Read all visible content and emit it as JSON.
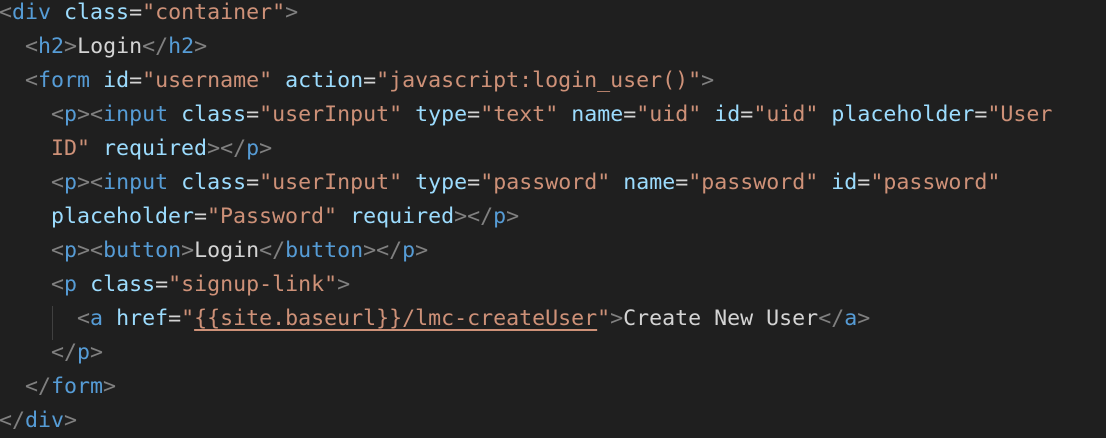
{
  "code_lines": [
    [
      {
        "t": "<",
        "c": "punct"
      },
      {
        "t": "div",
        "c": "tag"
      },
      {
        "t": " ",
        "c": "txt"
      },
      {
        "t": "class",
        "c": "attr"
      },
      {
        "t": "=",
        "c": "txt"
      },
      {
        "t": "\"container\"",
        "c": "str"
      },
      {
        "t": ">",
        "c": "punct"
      }
    ],
    [
      {
        "t": "  ",
        "c": "txt"
      },
      {
        "t": "<",
        "c": "punct"
      },
      {
        "t": "h2",
        "c": "tag"
      },
      {
        "t": ">",
        "c": "punct"
      },
      {
        "t": "Login",
        "c": "txt"
      },
      {
        "t": "</",
        "c": "punct"
      },
      {
        "t": "h2",
        "c": "tag"
      },
      {
        "t": ">",
        "c": "punct"
      }
    ],
    [
      {
        "t": "  ",
        "c": "txt"
      },
      {
        "t": "<",
        "c": "punct"
      },
      {
        "t": "form",
        "c": "tag"
      },
      {
        "t": " ",
        "c": "txt"
      },
      {
        "t": "id",
        "c": "attr"
      },
      {
        "t": "=",
        "c": "txt"
      },
      {
        "t": "\"username\"",
        "c": "str"
      },
      {
        "t": " ",
        "c": "txt"
      },
      {
        "t": "action",
        "c": "attr"
      },
      {
        "t": "=",
        "c": "txt"
      },
      {
        "t": "\"javascript:login_user()\"",
        "c": "str"
      },
      {
        "t": ">",
        "c": "punct"
      }
    ],
    [
      {
        "t": "    ",
        "c": "txt"
      },
      {
        "t": "<",
        "c": "punct"
      },
      {
        "t": "p",
        "c": "tag"
      },
      {
        "t": "><",
        "c": "punct"
      },
      {
        "t": "input",
        "c": "tag"
      },
      {
        "t": " ",
        "c": "txt"
      },
      {
        "t": "class",
        "c": "attr"
      },
      {
        "t": "=",
        "c": "txt"
      },
      {
        "t": "\"userInput\"",
        "c": "str"
      },
      {
        "t": " ",
        "c": "txt"
      },
      {
        "t": "type",
        "c": "attr"
      },
      {
        "t": "=",
        "c": "txt"
      },
      {
        "t": "\"text\"",
        "c": "str"
      },
      {
        "t": " ",
        "c": "txt"
      },
      {
        "t": "name",
        "c": "attr"
      },
      {
        "t": "=",
        "c": "txt"
      },
      {
        "t": "\"uid\"",
        "c": "str"
      },
      {
        "t": " ",
        "c": "txt"
      },
      {
        "t": "id",
        "c": "attr"
      },
      {
        "t": "=",
        "c": "txt"
      },
      {
        "t": "\"uid\"",
        "c": "str"
      },
      {
        "t": " ",
        "c": "txt"
      },
      {
        "t": "placeholder",
        "c": "attr"
      },
      {
        "t": "=",
        "c": "txt"
      },
      {
        "t": "\"User",
        "c": "str"
      }
    ],
    [
      {
        "t": "    ",
        "c": "txt"
      },
      {
        "t": "ID\"",
        "c": "str"
      },
      {
        "t": " ",
        "c": "txt"
      },
      {
        "t": "required",
        "c": "attr"
      },
      {
        "t": "></",
        "c": "punct"
      },
      {
        "t": "p",
        "c": "tag"
      },
      {
        "t": ">",
        "c": "punct"
      }
    ],
    [
      {
        "t": "    ",
        "c": "txt"
      },
      {
        "t": "<",
        "c": "punct"
      },
      {
        "t": "p",
        "c": "tag"
      },
      {
        "t": "><",
        "c": "punct"
      },
      {
        "t": "input",
        "c": "tag"
      },
      {
        "t": " ",
        "c": "txt"
      },
      {
        "t": "class",
        "c": "attr"
      },
      {
        "t": "=",
        "c": "txt"
      },
      {
        "t": "\"userInput\"",
        "c": "str"
      },
      {
        "t": " ",
        "c": "txt"
      },
      {
        "t": "type",
        "c": "attr"
      },
      {
        "t": "=",
        "c": "txt"
      },
      {
        "t": "\"password\"",
        "c": "str"
      },
      {
        "t": " ",
        "c": "txt"
      },
      {
        "t": "name",
        "c": "attr"
      },
      {
        "t": "=",
        "c": "txt"
      },
      {
        "t": "\"password\"",
        "c": "str"
      },
      {
        "t": " ",
        "c": "txt"
      },
      {
        "t": "id",
        "c": "attr"
      },
      {
        "t": "=",
        "c": "txt"
      },
      {
        "t": "\"password\"",
        "c": "str"
      }
    ],
    [
      {
        "t": "    ",
        "c": "txt"
      },
      {
        "t": "placeholder",
        "c": "attr"
      },
      {
        "t": "=",
        "c": "txt"
      },
      {
        "t": "\"Password\"",
        "c": "str"
      },
      {
        "t": " ",
        "c": "txt"
      },
      {
        "t": "required",
        "c": "attr"
      },
      {
        "t": "></",
        "c": "punct"
      },
      {
        "t": "p",
        "c": "tag"
      },
      {
        "t": ">",
        "c": "punct"
      }
    ],
    [
      {
        "t": "    ",
        "c": "txt"
      },
      {
        "t": "<",
        "c": "punct"
      },
      {
        "t": "p",
        "c": "tag"
      },
      {
        "t": "><",
        "c": "punct"
      },
      {
        "t": "button",
        "c": "tag"
      },
      {
        "t": ">",
        "c": "punct"
      },
      {
        "t": "Login",
        "c": "txt"
      },
      {
        "t": "</",
        "c": "punct"
      },
      {
        "t": "button",
        "c": "tag"
      },
      {
        "t": "></",
        "c": "punct"
      },
      {
        "t": "p",
        "c": "tag"
      },
      {
        "t": ">",
        "c": "punct"
      }
    ],
    [
      {
        "t": "    ",
        "c": "txt"
      },
      {
        "t": "<",
        "c": "punct"
      },
      {
        "t": "p",
        "c": "tag"
      },
      {
        "t": " ",
        "c": "txt"
      },
      {
        "t": "class",
        "c": "attr"
      },
      {
        "t": "=",
        "c": "txt"
      },
      {
        "t": "\"signup-link\"",
        "c": "str"
      },
      {
        "t": ">",
        "c": "punct"
      }
    ],
    [
      {
        "t": "      ",
        "c": "txt"
      },
      {
        "t": "<",
        "c": "punct"
      },
      {
        "t": "a",
        "c": "tag"
      },
      {
        "t": " ",
        "c": "txt"
      },
      {
        "t": "href",
        "c": "attr"
      },
      {
        "t": "=",
        "c": "txt"
      },
      {
        "t": "\"",
        "c": "str"
      },
      {
        "t": "{{site.baseurl}}/lmc-createUser",
        "c": "str underline"
      },
      {
        "t": "\"",
        "c": "str"
      },
      {
        "t": ">",
        "c": "punct"
      },
      {
        "t": "Create New User",
        "c": "txt"
      },
      {
        "t": "</",
        "c": "punct"
      },
      {
        "t": "a",
        "c": "tag"
      },
      {
        "t": ">",
        "c": "punct"
      }
    ],
    [
      {
        "t": "    ",
        "c": "txt"
      },
      {
        "t": "</",
        "c": "punct"
      },
      {
        "t": "p",
        "c": "tag"
      },
      {
        "t": ">",
        "c": "punct"
      }
    ],
    [
      {
        "t": "  ",
        "c": "txt"
      },
      {
        "t": "</",
        "c": "punct"
      },
      {
        "t": "form",
        "c": "tag"
      },
      {
        "t": ">",
        "c": "punct"
      }
    ],
    [
      {
        "t": "</",
        "c": "punct"
      },
      {
        "t": "div",
        "c": "tag"
      },
      {
        "t": ">",
        "c": "punct"
      }
    ]
  ]
}
